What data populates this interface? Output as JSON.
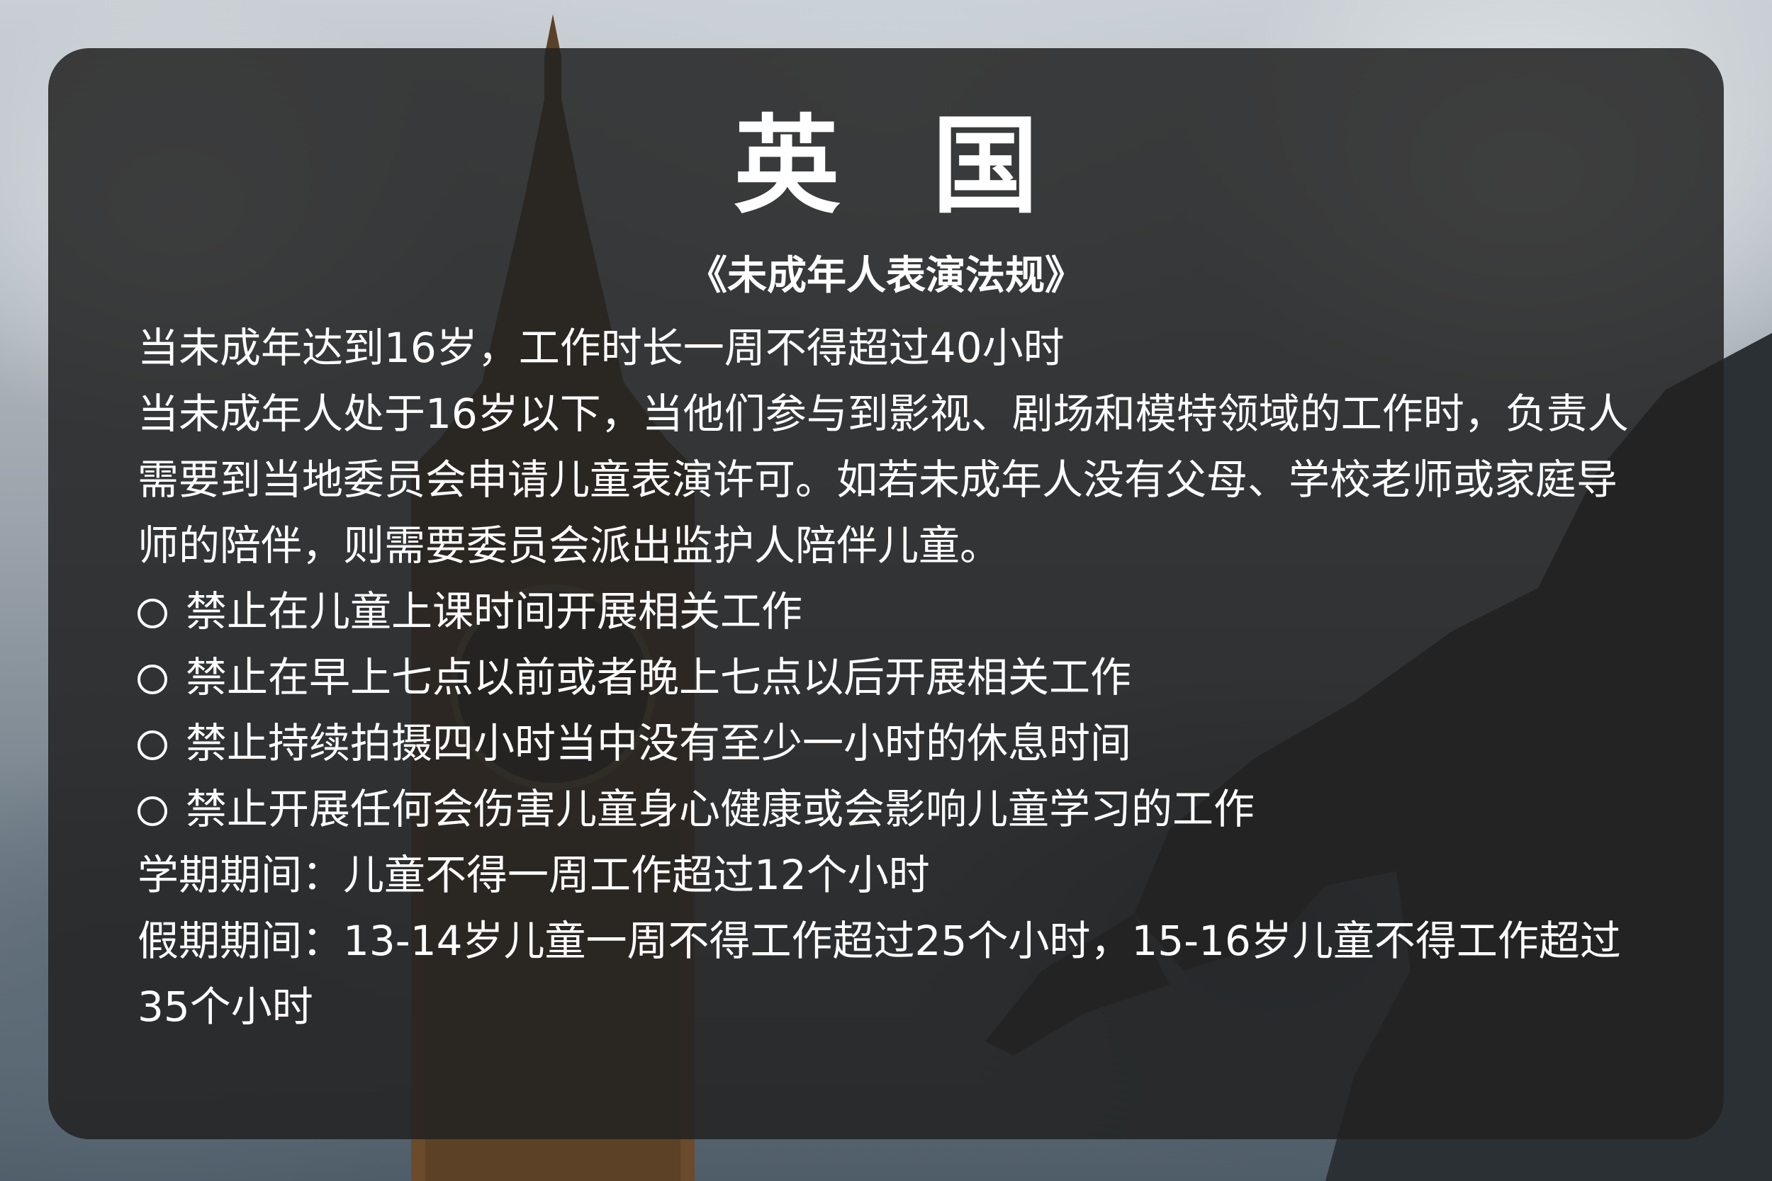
{
  "title": "英国",
  "subtitle": "《未成年人表演法规》",
  "paragraphs": [
    "当未成年达到16岁，工作时长一周不得超过40小时",
    "当未成年人处于16岁以下，当他们参与到影视、剧场和模特领域的工作时，负责人需要到当地委员会申请儿童表演许可。如若未成年人没有父母、学校老师或家庭导师的陪伴，则需要委员会派出监护人陪伴儿童。"
  ],
  "bullets": [
    "禁止在儿童上课时间开展相关工作",
    "禁止在早上七点以前或者晚上七点以后开展相关工作",
    "禁止持续拍摄四小时当中没有至少一小时的休息时间",
    "禁止开展任何会伤害儿童身心健康或会影响儿童学习的工作"
  ],
  "notes": [
    "学期期间：儿童不得一周工作超过12个小时",
    "假期期间：13-14岁儿童一周不得工作超过25个小时，15-16岁儿童不得工作超过35个小时"
  ],
  "colors": {
    "card": "#222222",
    "text": "#ffffff"
  }
}
